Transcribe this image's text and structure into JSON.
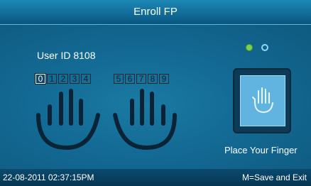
{
  "title": "Enroll FP",
  "user_id_label": "User ID 8108",
  "fingers": {
    "left": [
      "0",
      "1",
      "2",
      "3",
      "4"
    ],
    "right": [
      "5",
      "6",
      "7",
      "8",
      "9"
    ],
    "selected": "0"
  },
  "progress": {
    "completed": 1,
    "total": 2,
    "active_color": "#7bd24a"
  },
  "scanner": {
    "icon": "hand-icon"
  },
  "prompt": "Place Your Finger",
  "status": {
    "datetime": "22-08-2011  02:37:15PM",
    "hint": "M=Save and Exit"
  }
}
